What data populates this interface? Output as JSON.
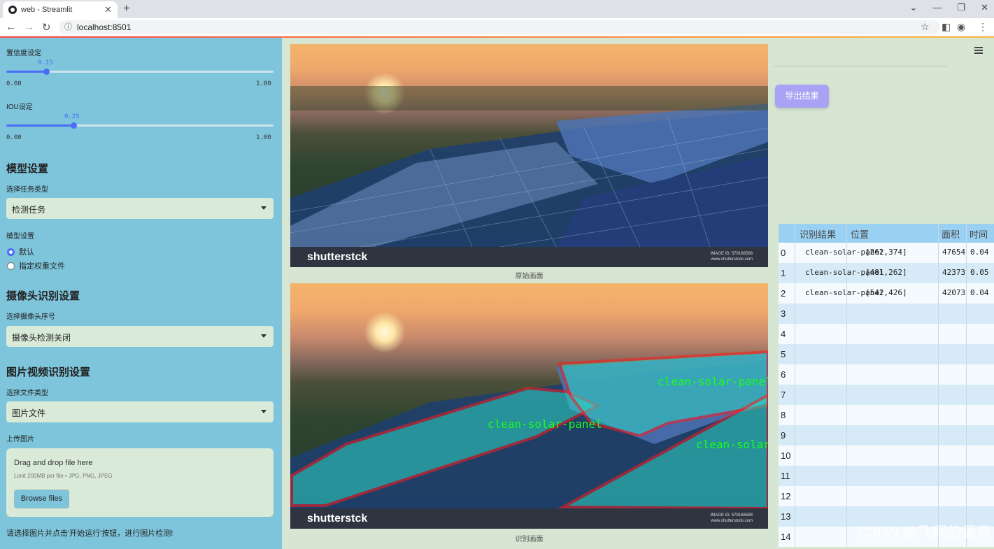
{
  "browser": {
    "tab_title": "web - Streamlit",
    "url": "localhost:8501"
  },
  "sidebar": {
    "confidence": {
      "label": "置信度设定",
      "value": "0.15",
      "min": "0.00",
      "max": "1.00",
      "fraction": 0.15
    },
    "iou": {
      "label": "IOU设定",
      "value": "0.25",
      "min": "0.00",
      "max": "1.00",
      "fraction": 0.25
    },
    "model_header": "模型设置",
    "task_label": "选择任务类型",
    "task_value": "检测任务",
    "model_setting_label": "模型设置",
    "radio_default": "默认",
    "radio_custom": "指定权重文件",
    "camera_header": "摄像头识别设置",
    "camera_label": "选择摄像头序号",
    "camera_value": "摄像头检测关闭",
    "media_header": "图片视频识别设置",
    "file_type_label": "选择文件类型",
    "file_type_value": "图片文件",
    "upload_label": "上传图片",
    "drop_text": "Drag and drop file here",
    "limit_text": "Limit 200MB per file • JPG, PNG, JPEG",
    "browse_label": "Browse files",
    "footer_text": "请选择图片并点击'开始运行'按钮，进行图片检测!"
  },
  "main": {
    "watermark_logo": "shutterstck",
    "image_id_line1": "IMAGE ID: 578166598",
    "image_id_line2": "www.shutterstock.com",
    "caption_original": "原始画面",
    "caption_detected": "识别画面",
    "export_button": "导出结果",
    "detection_label": "clean-solar-panel"
  },
  "table": {
    "headers": [
      "",
      "识别结果",
      "位置",
      "面积",
      "时间"
    ],
    "rows": [
      {
        "idx": "0",
        "result": "clean-solar-panel",
        "pos": "[262,374]",
        "area": "47654",
        "time": "0.04"
      },
      {
        "idx": "1",
        "result": "clean-solar-panel",
        "pos": "[481,262]",
        "area": "42373",
        "time": "0.05"
      },
      {
        "idx": "2",
        "result": "clean-solar-panel",
        "pos": "[542,426]",
        "area": "42073",
        "time": "0.04"
      },
      {
        "idx": "3"
      },
      {
        "idx": "4"
      },
      {
        "idx": "5"
      },
      {
        "idx": "6"
      },
      {
        "idx": "7"
      },
      {
        "idx": "8"
      },
      {
        "idx": "9"
      },
      {
        "idx": "10"
      },
      {
        "idx": "11"
      },
      {
        "idx": "12"
      },
      {
        "idx": "13"
      },
      {
        "idx": "14"
      }
    ]
  },
  "csdn_watermark": "CSDN @飞翔的佩奇",
  "colors": {
    "sidebar": "#7ec5dc",
    "main": "#d6e6d3",
    "accent": "#4a6cf7",
    "button": "#a9a3f5",
    "box": "#ff1a1a",
    "label": "#19ff19"
  }
}
